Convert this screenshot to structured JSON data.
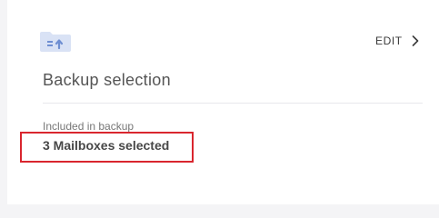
{
  "card": {
    "icon": "folder-upload-icon",
    "edit_label": "EDIT",
    "edit_icon": "chevron-right-icon",
    "title": "Backup selection",
    "included_label": "Included in backup",
    "selection_value": "3 Mailboxes selected"
  },
  "colors": {
    "icon_fill": "#d9e2f5",
    "icon_accent": "#6f8fd2",
    "highlight": "#d9262e"
  }
}
